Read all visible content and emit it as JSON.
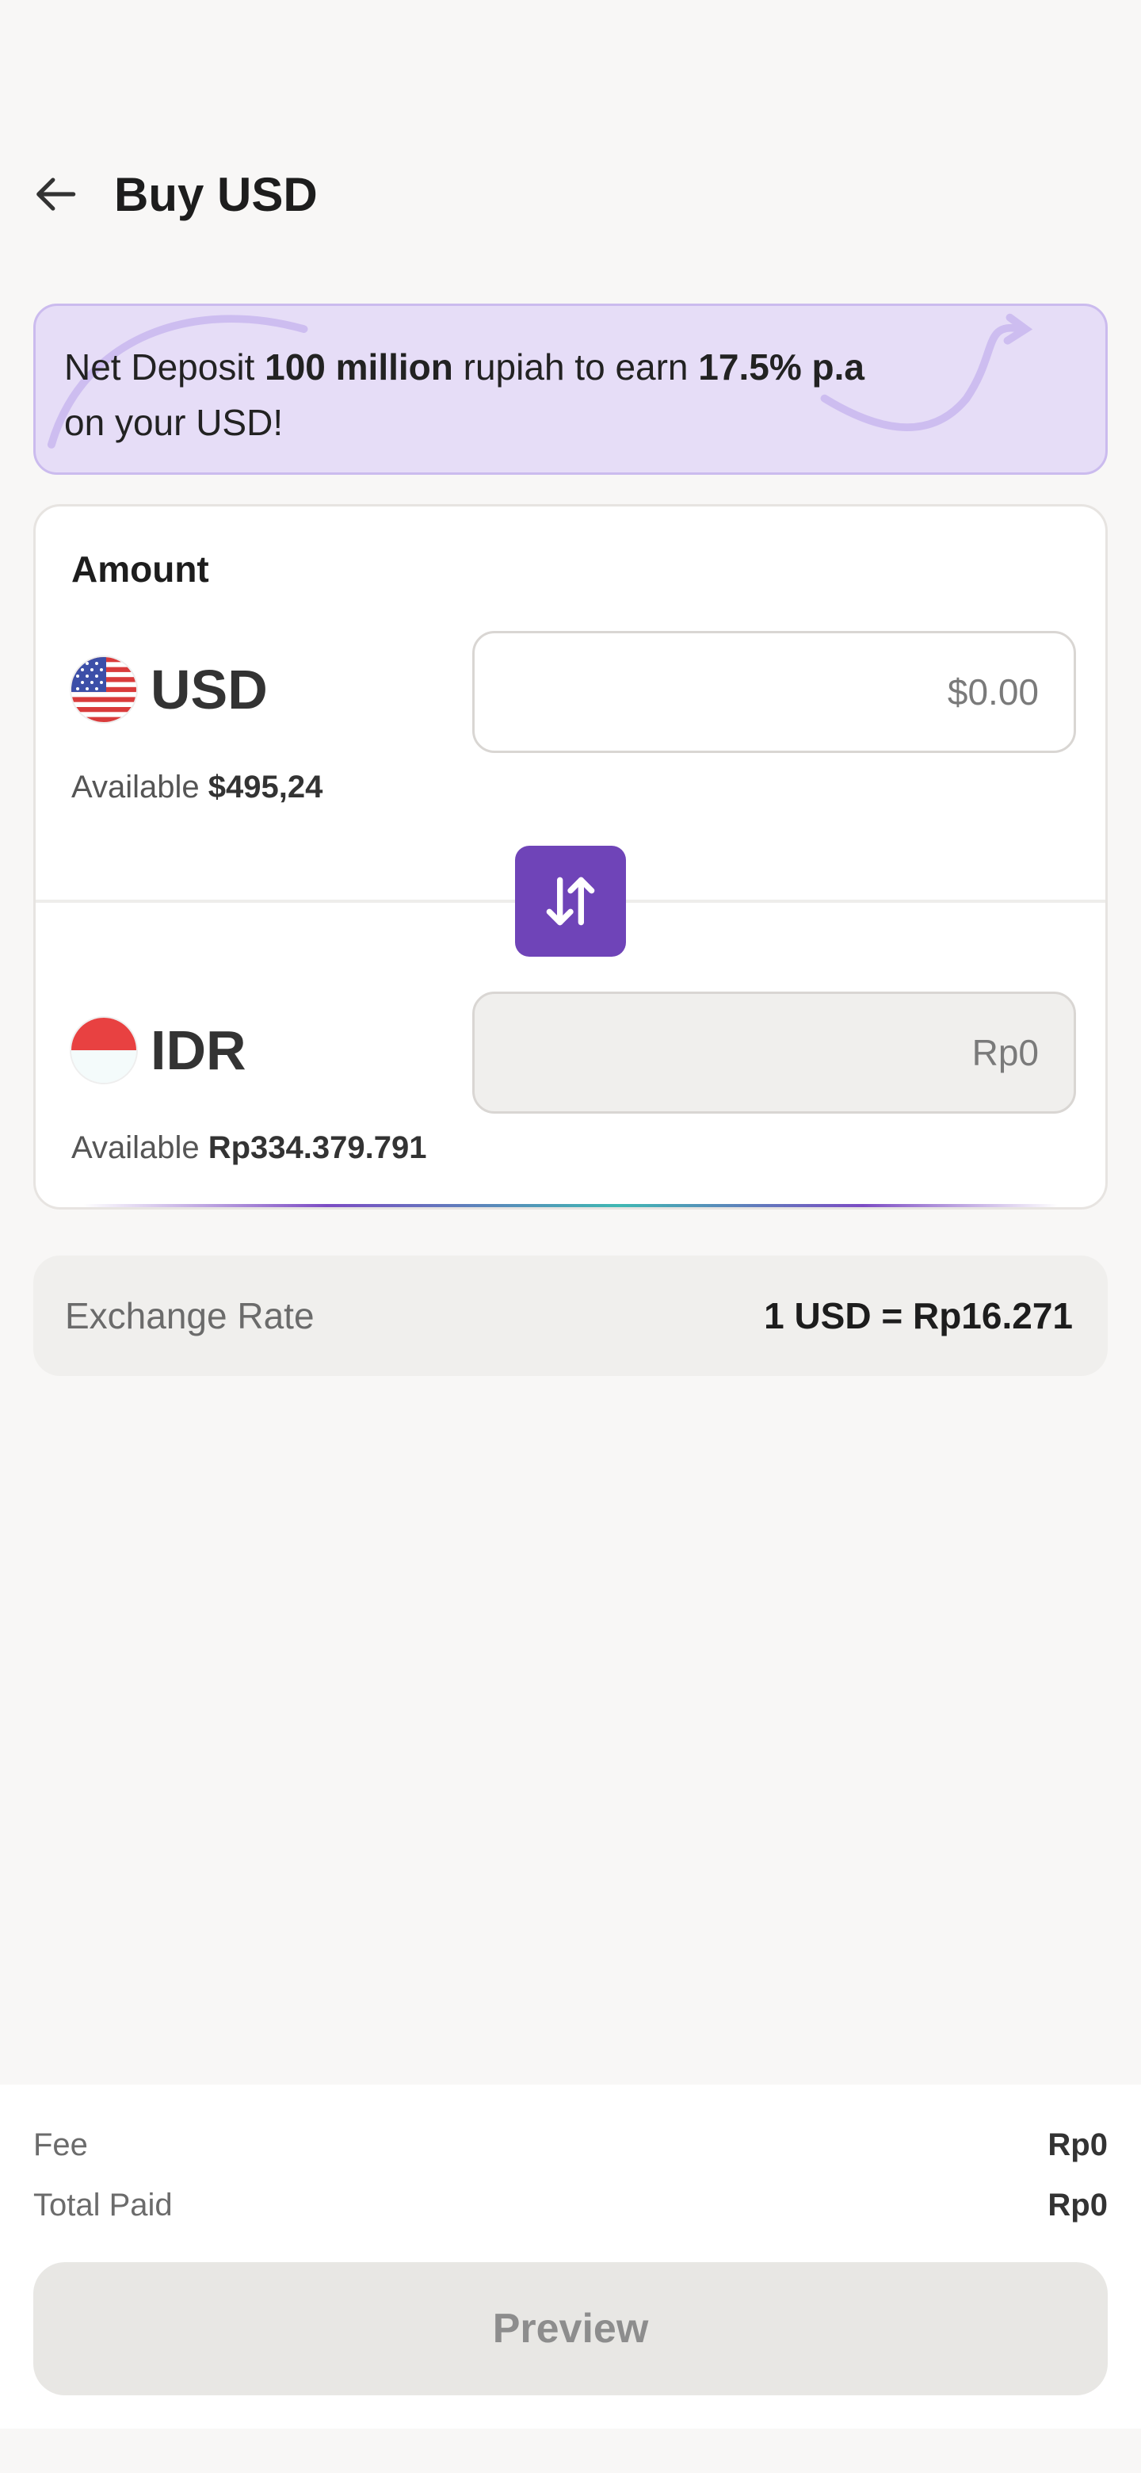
{
  "header": {
    "title": "Buy USD",
    "back_icon": "arrow-left-icon"
  },
  "promo": {
    "text_1": "Net Deposit ",
    "bold_1": "100 million",
    "text_2": " rupiah to earn ",
    "bold_2": "17.5% p.a",
    "text_3": " on your USD!"
  },
  "amount": {
    "label": "Amount",
    "from": {
      "code": "USD",
      "flag_icon": "us-flag-icon",
      "placeholder": "$0.00",
      "available_label": "Available",
      "available_value": "$495,24"
    },
    "to": {
      "code": "IDR",
      "flag_icon": "indonesia-flag-icon",
      "placeholder": "Rp0",
      "available_label": "Available",
      "available_value": "Rp334.379.791"
    },
    "swap_icon": "swap-vertical-icon"
  },
  "exchange_rate": {
    "label": "Exchange Rate",
    "value": "1 USD = Rp16.271"
  },
  "summary": {
    "fee_label": "Fee",
    "fee_value": "Rp0",
    "total_label": "Total Paid",
    "total_value": "Rp0"
  },
  "actions": {
    "preview_label": "Preview"
  },
  "colors": {
    "accent": "#6f44b8",
    "promo_bg": "#e6ddf7",
    "page_bg": "#f8f7f6"
  }
}
